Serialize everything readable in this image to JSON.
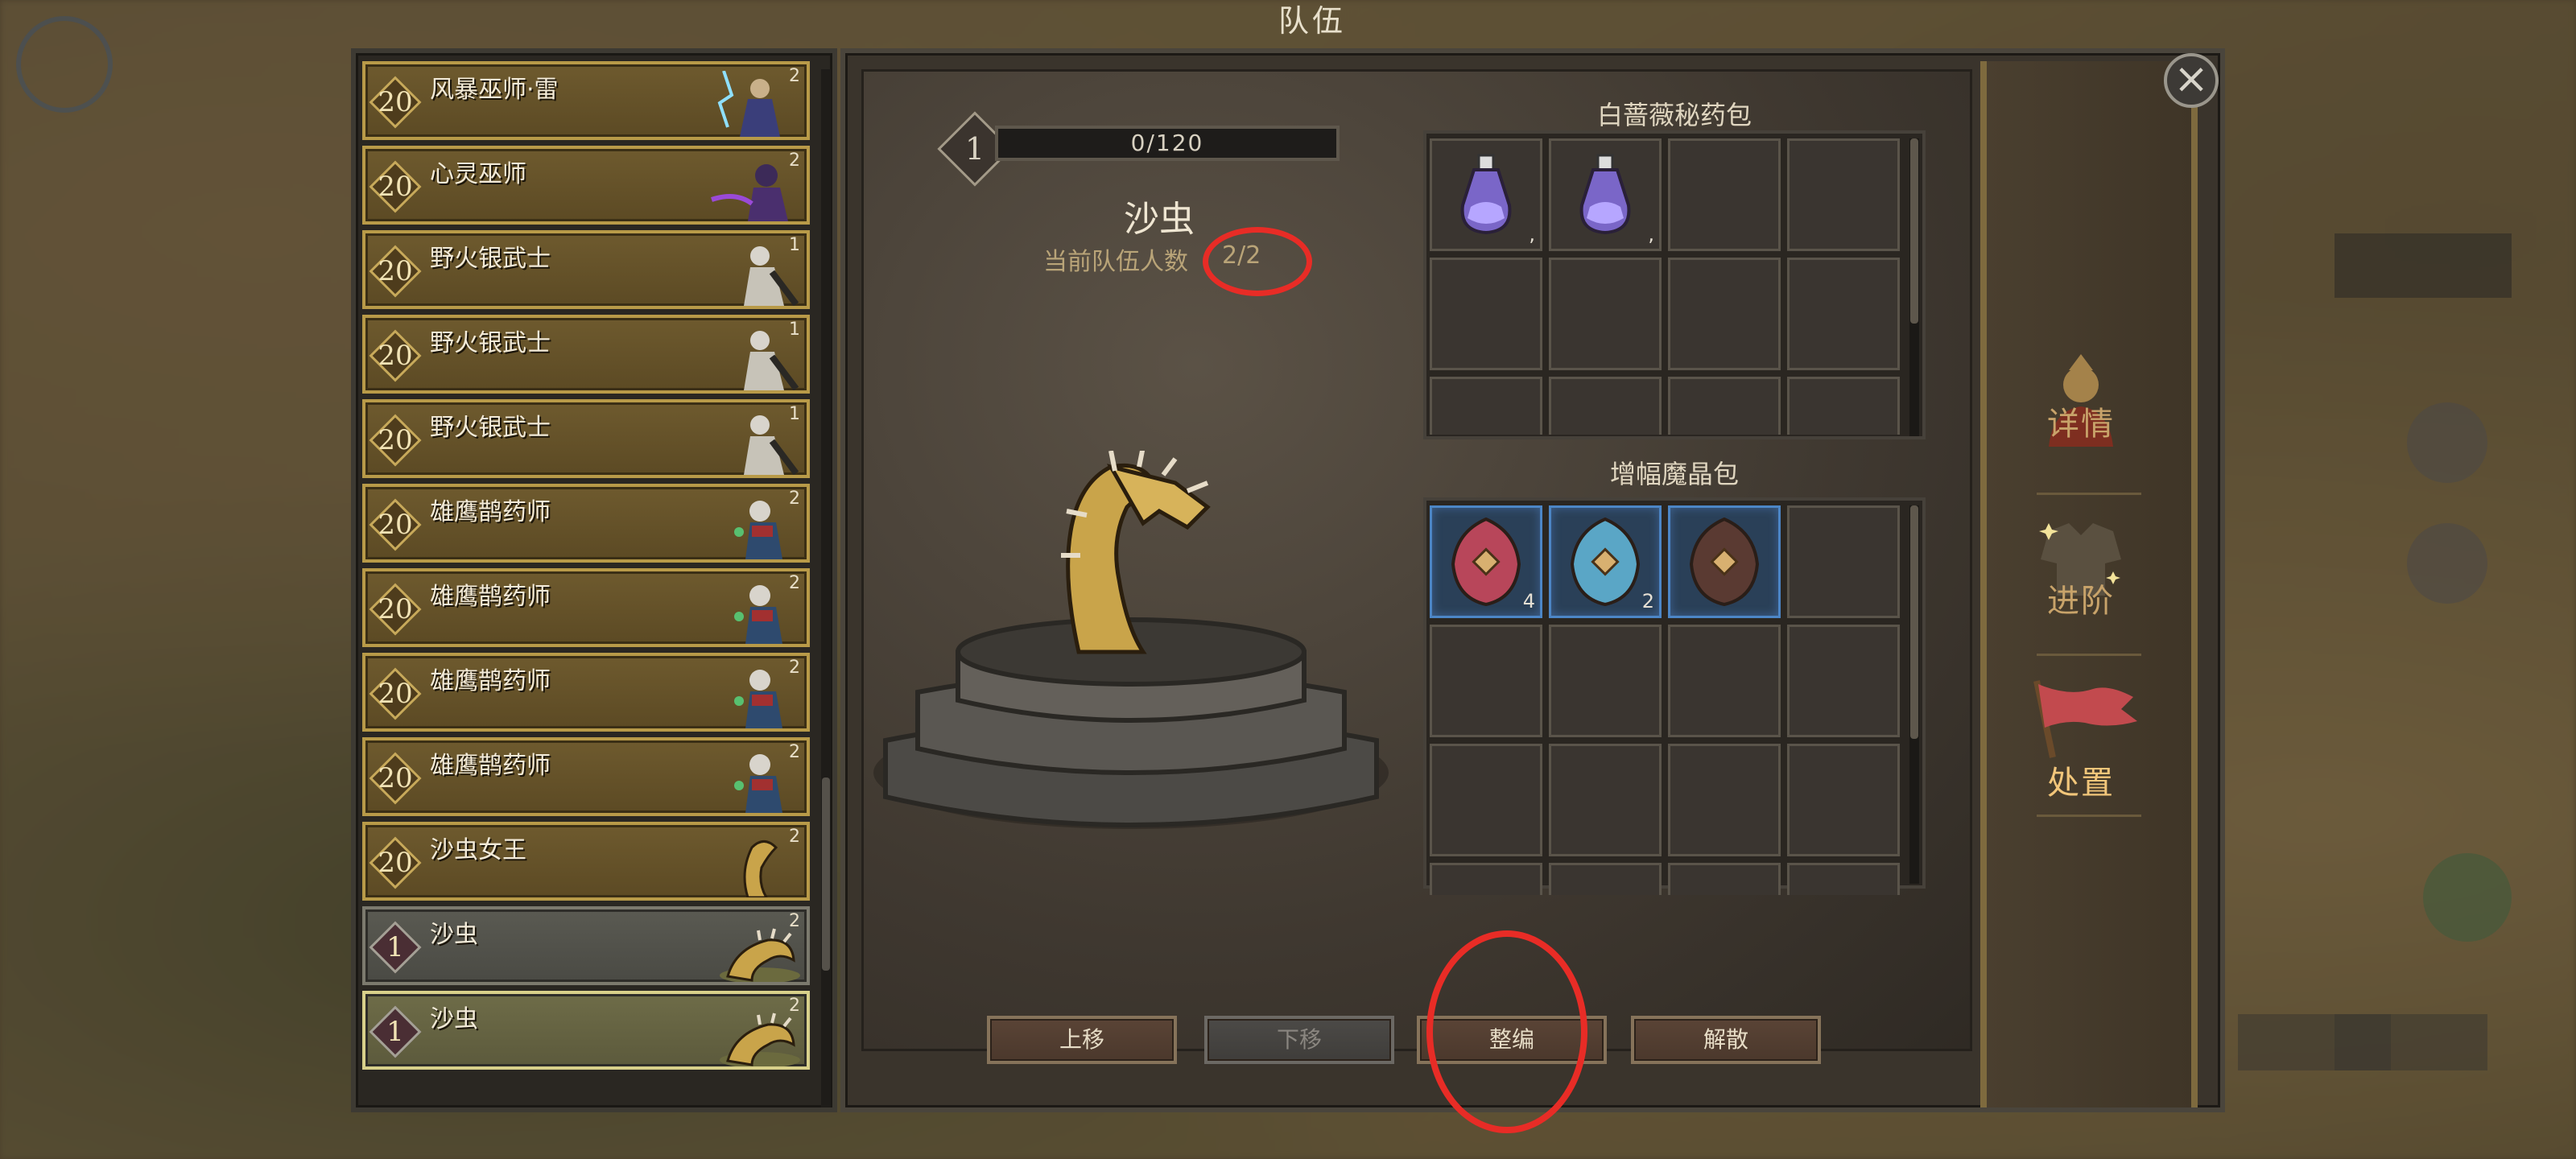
{
  "window": {
    "title": "队伍"
  },
  "units": [
    {
      "level": "20",
      "name": "风暴巫师·雷",
      "count": "2",
      "style": "gold"
    },
    {
      "level": "20",
      "name": "心灵巫师",
      "count": "2",
      "style": "gold"
    },
    {
      "level": "20",
      "name": "野火银武士",
      "count": "1",
      "style": "gold"
    },
    {
      "level": "20",
      "name": "野火银武士",
      "count": "1",
      "style": "gold"
    },
    {
      "level": "20",
      "name": "野火银武士",
      "count": "1",
      "style": "gold"
    },
    {
      "level": "20",
      "name": "雄鹰鹊药师",
      "count": "2",
      "style": "gold"
    },
    {
      "level": "20",
      "name": "雄鹰鹊药师",
      "count": "2",
      "style": "gold"
    },
    {
      "level": "20",
      "name": "雄鹰鹊药师",
      "count": "2",
      "style": "gold"
    },
    {
      "level": "20",
      "name": "雄鹰鹊药师",
      "count": "2",
      "style": "gold"
    },
    {
      "level": "20",
      "name": "沙虫女王",
      "count": "2",
      "style": "gold"
    },
    {
      "level": "1",
      "name": "沙虫",
      "count": "2",
      "style": "grey"
    },
    {
      "level": "1",
      "name": "沙虫",
      "count": "2",
      "style": "selected"
    }
  ],
  "detail": {
    "level": "1",
    "exp": "0/120",
    "name": "沙虫",
    "party_count_label": "当前队伍人数",
    "party_count_value": "2/2"
  },
  "inventory": {
    "potion_title": "白蔷薇秘药包",
    "potion_items": [
      {
        "icon": "potion-icon",
        "qty": ","
      },
      {
        "icon": "potion-icon",
        "qty": ","
      }
    ],
    "crystal_title": "增幅魔晶包",
    "crystal_items": [
      {
        "icon": "red-crystal-icon",
        "qty": "4",
        "color": "#b8465a"
      },
      {
        "icon": "blue-crystal-icon",
        "qty": "2",
        "color": "#5aa6c6"
      },
      {
        "icon": "dark-crystal-icon",
        "qty": "",
        "color": "#5a3a32"
      }
    ]
  },
  "actions": {
    "move_up": "上移",
    "move_down": "下移",
    "reorganize": "整编",
    "disband": "解散"
  },
  "sidebar": {
    "details": "详情",
    "advance": "进阶",
    "dispose": "处置"
  },
  "colors": {
    "annotation": "#e82c26",
    "gold_border": "#b89a48",
    "accent": "#f2c67a"
  }
}
